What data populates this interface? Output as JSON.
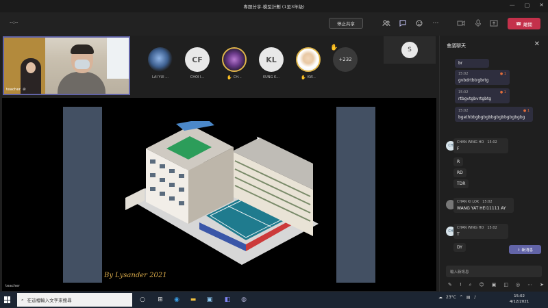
{
  "titlebar": {
    "title": "專題分享-模型計劃 (1至3年級)",
    "minimize": "—",
    "maximize": "▢",
    "close": "✕"
  },
  "toolbar": {
    "timer": "--:--",
    "share_label": "停止共享",
    "leave_label": "離開",
    "icons": [
      "people-icon",
      "chat-icon",
      "reactions-icon",
      "more-icon",
      "camera-icon",
      "mic-icon",
      "share-tray-icon"
    ]
  },
  "self_video": {
    "label": "teacher"
  },
  "participants": [
    {
      "initials": "",
      "name": "LAI YUI ...",
      "raised": false
    },
    {
      "initials": "CF",
      "name": "CHOI I...",
      "raised": false
    },
    {
      "initials": "",
      "name": "CH...",
      "raised": true
    },
    {
      "initials": "KL",
      "name": "KUNG K...",
      "raised": false
    },
    {
      "initials": "",
      "name": "KW...",
      "raised": true
    }
  ],
  "more_participants": "+232",
  "spotlight_initial": "S",
  "shared_screen": {
    "signature": "By Lysander 2021",
    "presenter_label": "teacher"
  },
  "chat": {
    "title": "會議聊天",
    "messages_own": [
      {
        "text": "br"
      },
      {
        "time": "15:02",
        "reaction": "1",
        "text": "gvbdrtbtrgbrtg"
      },
      {
        "time": "15:02",
        "reaction": "1",
        "text": "rtbgvtgbvrtgbtg"
      },
      {
        "time": "15:02",
        "reaction": "1",
        "text": "bgethbbgbgbgbbgbgbbgbgbgbg"
      }
    ],
    "messages_other": [
      {
        "initials": "CH",
        "name": "CHAN WING HO",
        "time": "15:02",
        "lines": [
          "F",
          "R",
          "RD",
          "TDR"
        ]
      },
      {
        "initials": "",
        "name": "CHAN KI LOK",
        "time": "15:02",
        "lines": [
          "WANG YAT HEI11111 AY"
        ]
      },
      {
        "initials": "CH",
        "name": "CHAN WING HO",
        "time": "15:02",
        "lines": [
          "T",
          "DY"
        ]
      }
    ],
    "new_messages_label": "新消息",
    "compose_placeholder": "輸入新訊息"
  },
  "taskbar": {
    "search_placeholder": "在這裡輸入文字來搜尋",
    "weather": "23°C",
    "time": "15:02",
    "date": "4/12/2021"
  }
}
